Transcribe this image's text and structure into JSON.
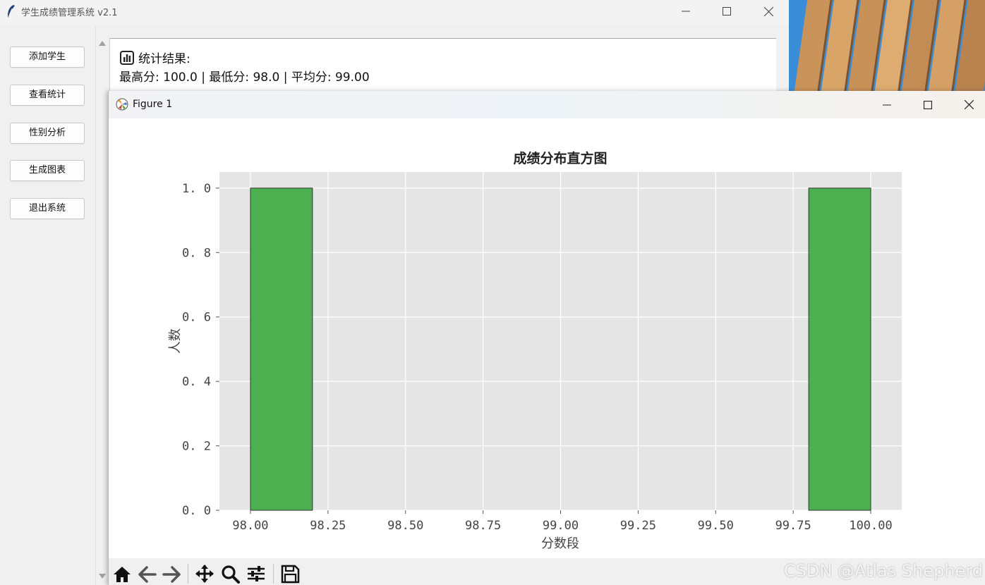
{
  "main_window": {
    "title": "学生成绩管理系统 v2.1"
  },
  "sidebar": {
    "items": [
      {
        "label": "添加学生"
      },
      {
        "label": "查看统计"
      },
      {
        "label": "性别分析"
      },
      {
        "label": "生成图表"
      },
      {
        "label": "退出系统"
      }
    ]
  },
  "result": {
    "title": "统计结果:",
    "stats_line": "最高分: 100.0 | 最低分: 98.0 | 平均分: 99.00"
  },
  "figure_window": {
    "title": "Figure 1"
  },
  "chart_data": {
    "type": "bar",
    "title": "成绩分布直方图",
    "xlabel": "分数段",
    "ylabel": "人数",
    "xlim": [
      97.9,
      100.1
    ],
    "ylim": [
      0,
      1.05
    ],
    "x_ticks": [
      "98.00",
      "98.25",
      "98.50",
      "98.75",
      "99.00",
      "99.25",
      "99.50",
      "99.75",
      "100.00"
    ],
    "y_ticks": [
      "0.0",
      "0.2",
      "0.4",
      "0.6",
      "0.8",
      "1.0"
    ],
    "bins": [
      {
        "start": 98.0,
        "end": 98.2,
        "count": 1
      },
      {
        "start": 99.8,
        "end": 100.0,
        "count": 1
      }
    ],
    "bar_color": "#4caf50",
    "background_color": "#e5e5e5",
    "grid": true
  },
  "watermark": "CSDN @Atlas Shepherd",
  "colors": {
    "accent_green": "#4caf50",
    "plot_bg": "#e5e5e5"
  }
}
